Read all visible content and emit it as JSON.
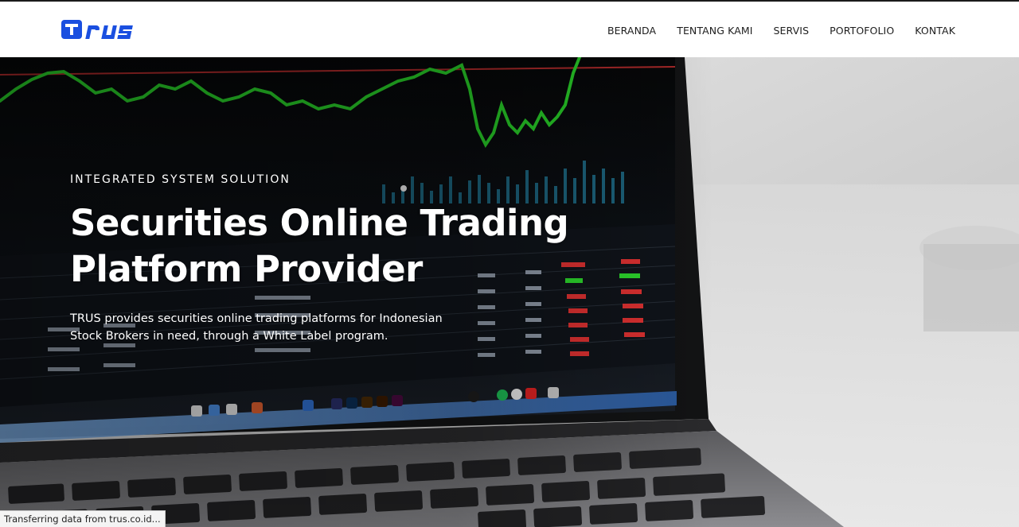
{
  "header": {
    "logo_text": "TRUS",
    "nav": [
      "BERANDA",
      "TENTANG KAMI",
      "SERVIS",
      "PORTOFOLIO",
      "KONTAK"
    ]
  },
  "hero": {
    "eyebrow": "INTEGRATED SYSTEM SOLUTION",
    "title": "Securities Online Trading Platform Provider",
    "description": "TRUS provides securities online trading platforms for Indonesian Stock Brokers in need, through a White Label program.",
    "image_subject": "laptop-trading-chart"
  },
  "status_bar": {
    "text": "Transferring data from trus.co.id..."
  },
  "colors": {
    "brand_blue": "#1a4fe0",
    "chart_green": "#2bd12b",
    "chart_red": "#d93030"
  }
}
